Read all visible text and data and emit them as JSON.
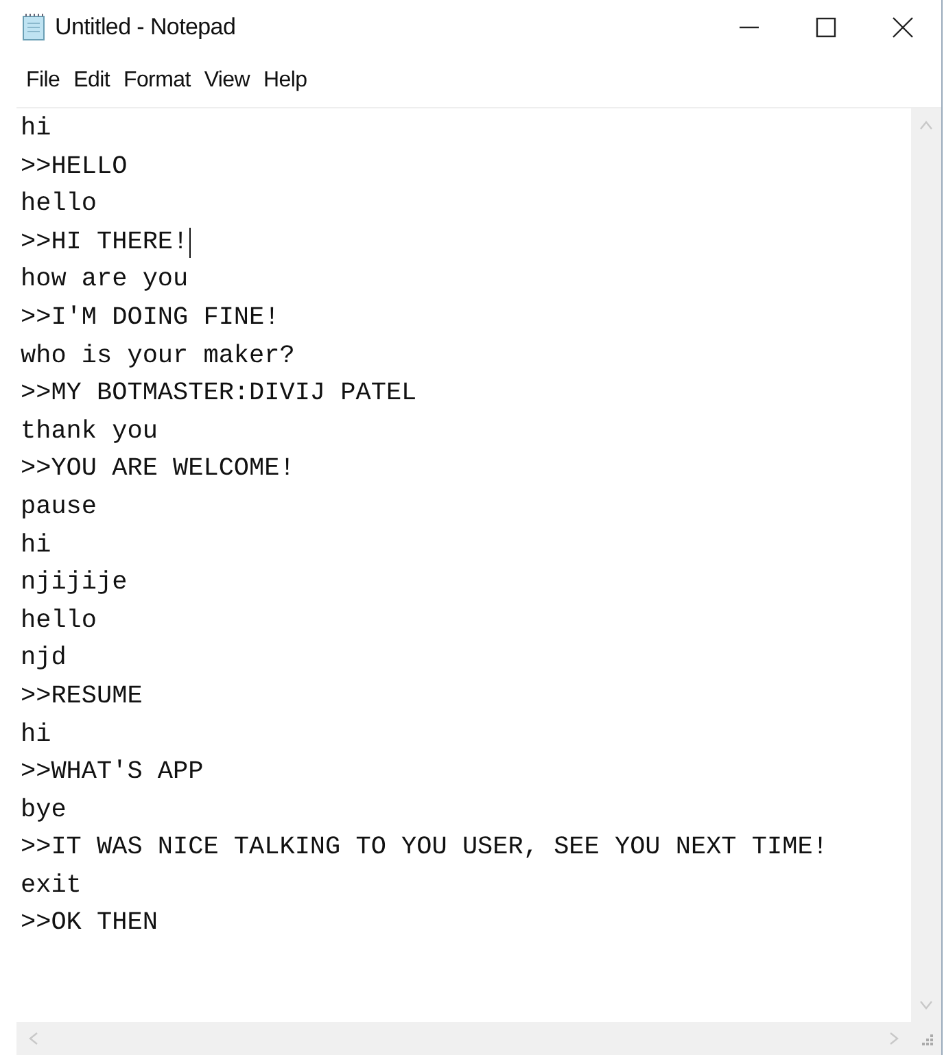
{
  "window": {
    "title": "Untitled - Notepad"
  },
  "menu": [
    "File",
    "Edit",
    "Format",
    "View",
    "Help"
  ],
  "lines": [
    {
      "text": "hi",
      "caret": false
    },
    {
      "text": ">>HELLO",
      "caret": false
    },
    {
      "text": "hello",
      "caret": false
    },
    {
      "text": ">>HI THERE!",
      "caret": true
    },
    {
      "text": "how are you",
      "caret": false
    },
    {
      "text": ">>I'M DOING FINE!",
      "caret": false
    },
    {
      "text": "who is your maker?",
      "caret": false
    },
    {
      "text": ">>MY BOTMASTER:DIVIJ PATEL",
      "caret": false
    },
    {
      "text": "thank you",
      "caret": false
    },
    {
      "text": ">>YOU ARE WELCOME!",
      "caret": false
    },
    {
      "text": "pause",
      "caret": false
    },
    {
      "text": "hi",
      "caret": false
    },
    {
      "text": "njijije",
      "caret": false
    },
    {
      "text": "hello",
      "caret": false
    },
    {
      "text": "njd",
      "caret": false
    },
    {
      "text": ">>RESUME",
      "caret": false
    },
    {
      "text": "hi",
      "caret": false
    },
    {
      "text": ">>WHAT'S APP",
      "caret": false
    },
    {
      "text": "bye",
      "caret": false
    },
    {
      "text": ">>IT WAS NICE TALKING TO YOU USER, SEE YOU NEXT TIME!",
      "caret": false
    },
    {
      "text": "exit",
      "caret": false
    },
    {
      "text": ">>OK THEN",
      "caret": false
    }
  ]
}
